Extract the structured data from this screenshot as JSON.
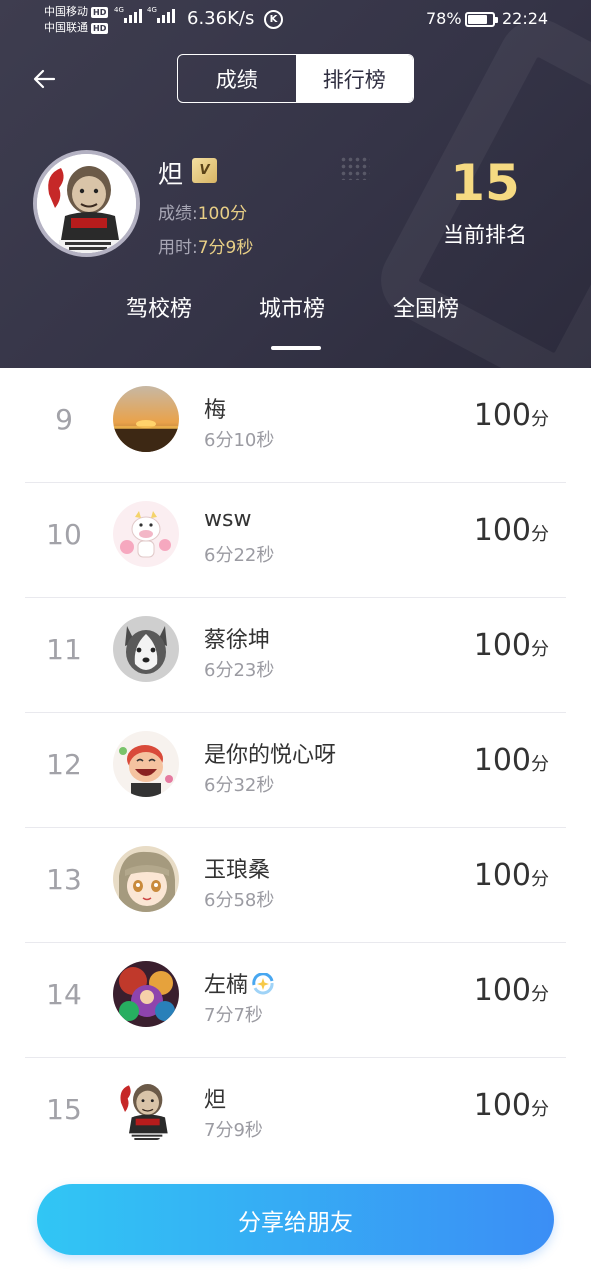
{
  "status_bar": {
    "carrier_1": "中国移动",
    "carrier_2": "中国联通",
    "hd_label": "HD",
    "network_1": "4G",
    "network_2": "4G",
    "speed": "6.36K/s",
    "k_icon_letter": "K",
    "battery_percent": "78%",
    "battery_level": 0.78,
    "time": "22:24"
  },
  "nav": {
    "back_icon": "arrow-left-icon",
    "tabs": [
      {
        "label": "成绩",
        "active": false
      },
      {
        "label": "排行榜",
        "active": true
      }
    ]
  },
  "profile": {
    "name": "炟",
    "vip_label": "VIP",
    "score_label": "成绩:",
    "score_value": "100分",
    "time_label": "用时:",
    "time_value": "7分9秒",
    "rank_number": "15",
    "rank_label": "当前排名"
  },
  "scope_tabs": [
    {
      "label": "驾校榜",
      "active": false
    },
    {
      "label": "城市榜",
      "active": true
    },
    {
      "label": "全国榜",
      "active": false
    }
  ],
  "leaderboard": [
    {
      "rank": "9",
      "name": "梅",
      "time": "6分10秒",
      "score": "100",
      "unit": "分",
      "avatar": "sunset-avatar"
    },
    {
      "rank": "10",
      "name": "wsw",
      "time": "6分22秒",
      "score": "100",
      "unit": "分",
      "avatar": "cartoon-cow-avatar"
    },
    {
      "rank": "11",
      "name": "蔡徐坤",
      "time": "6分23秒",
      "score": "100",
      "unit": "分",
      "avatar": "husky-avatar"
    },
    {
      "rank": "12",
      "name": "是你的悦心呀",
      "time": "6分32秒",
      "score": "100",
      "unit": "分",
      "avatar": "cartoon-laugh-avatar"
    },
    {
      "rank": "13",
      "name": "玉琅桑",
      "time": "6分58秒",
      "score": "100",
      "unit": "分",
      "avatar": "anime-girl-avatar"
    },
    {
      "rank": "14",
      "name": "左楠",
      "time": "7分7秒",
      "score": "100",
      "unit": "分",
      "avatar": "colorful-art-avatar",
      "name_emoji": "sparkle-emoji"
    },
    {
      "rank": "15",
      "name": "炟",
      "time": "7分9秒",
      "score": "100",
      "unit": "分",
      "avatar": "meme-avatar"
    }
  ],
  "share_button": "分享给朋友",
  "colors": {
    "header_bg": "#3a394b",
    "gold": "#f6da82",
    "button_start": "#31c6f4",
    "button_end": "#3b8ef5"
  }
}
